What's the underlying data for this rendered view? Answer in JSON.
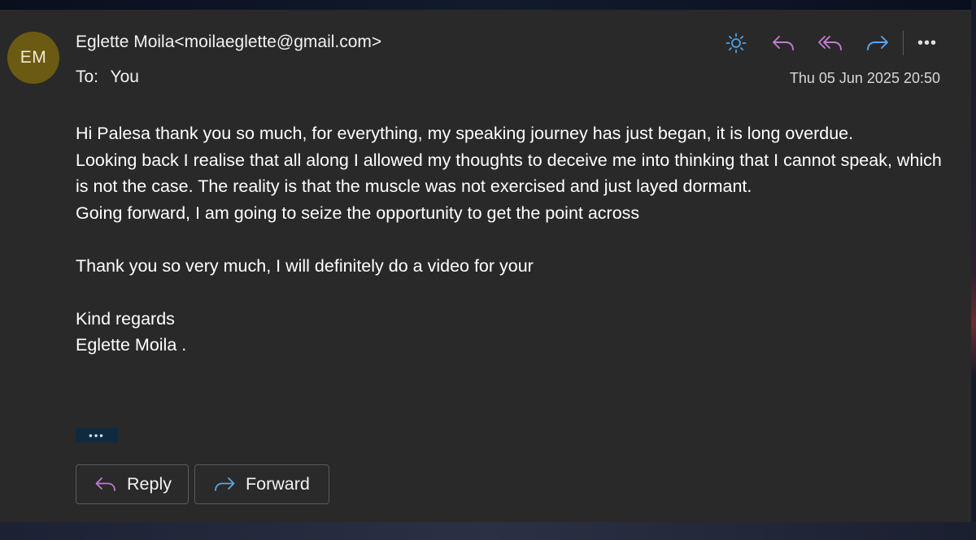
{
  "message": {
    "avatar_initials": "EM",
    "sender": "Eglette Moila<moilaeglette@gmail.com>",
    "to_label": "To:",
    "to_value": "You",
    "timestamp": "Thu 05 Jun 2025 20:50",
    "body": {
      "para1": "Hi Palesa thank you so much, for everything, my speaking journey has just began, it is long overdue.",
      "para2": "Looking back I realise that all along I allowed my thoughts to deceive me into thinking that I cannot speak, which is not the case. The reality is that the muscle was not exercised and just layed dormant.",
      "para3": "Going forward, I am going to seize the opportunity to get the point across",
      "para4": "Thank you so very much, I will definitely do a video for your",
      "closing1": "Kind regards",
      "closing2": "Eglette Moila ."
    },
    "show_more": "•••"
  },
  "toolbar": {
    "icons": [
      "sun-icon",
      "reply-icon",
      "reply-all-icon",
      "forward-icon",
      "more-icon"
    ],
    "more_label": "•••"
  },
  "actions": {
    "reply_label": "Reply",
    "forward_label": "Forward"
  },
  "colors": {
    "card_bg": "#292929",
    "avatar_bg": "#6b5a12",
    "sun_icon": "#4aa3e8",
    "reply_icon": "#c27bd1",
    "forward_icon": "#5aa6ea",
    "show_more_bg": "#0f2a3f"
  }
}
